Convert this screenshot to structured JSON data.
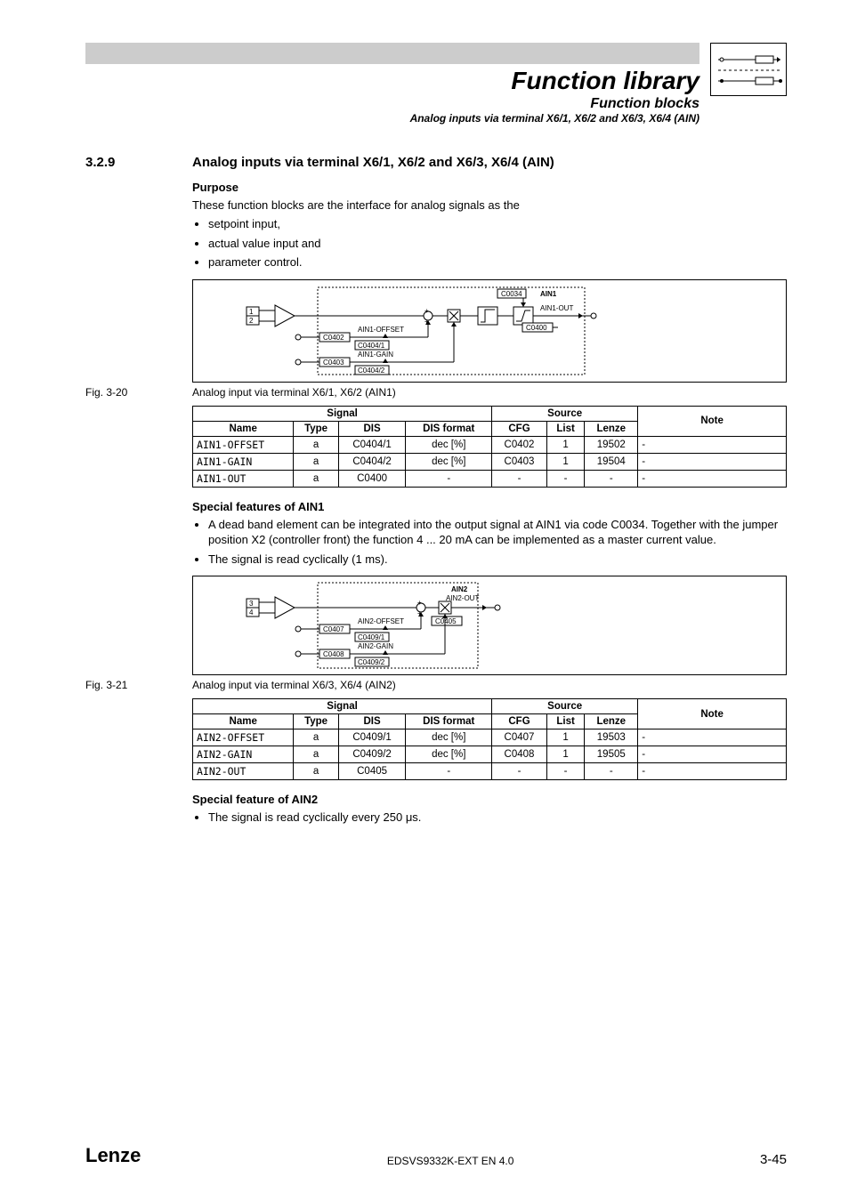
{
  "header": {
    "title": "Function library",
    "subtitle": "Function blocks",
    "smallTitle": "Analog inputs via terminal X6/1, X6/2 and X6/3, X6/4 (AIN)"
  },
  "section": {
    "num": "3.2.9",
    "title": "Analog inputs via terminal X6/1, X6/2 and X6/3, X6/4 (AIN)"
  },
  "purpose": {
    "head": "Purpose",
    "intro": "These function blocks are the interface for analog signals as the",
    "items": [
      "setpoint input,",
      "actual value input and",
      "parameter control."
    ]
  },
  "fig1": {
    "label": "Fig. 3-20",
    "caption": "Analog input via terminal X6/1, X6/2 (AIN1)"
  },
  "diagram1": {
    "name": "AIN1",
    "output": "AIN1-OUT",
    "pins": [
      "1",
      "2"
    ],
    "offset_label": "AIN1-OFFSET",
    "offset_code": "C0402",
    "offset_sub": "C0404/1",
    "gain_label": "AIN1-GAIN",
    "gain_code": "C0403",
    "gain_sub": "C0404/2",
    "extra_top": "C0034",
    "extra_out": "C0400"
  },
  "table1": {
    "headers": {
      "signal": "Signal",
      "name": "Name",
      "type": "Type",
      "dis": "DIS",
      "fmt": "DIS format",
      "source": "Source",
      "cfg": "CFG",
      "list": "List",
      "lenze": "Lenze",
      "note": "Note"
    },
    "rows": [
      {
        "name": "AIN1-OFFSET",
        "type": "a",
        "dis": "C0404/1",
        "fmt": "dec [%]",
        "cfg": "C0402",
        "list": "1",
        "lenze": "19502",
        "note": "-"
      },
      {
        "name": "AIN1-GAIN",
        "type": "a",
        "dis": "C0404/2",
        "fmt": "dec [%]",
        "cfg": "C0403",
        "list": "1",
        "lenze": "19504",
        "note": "-"
      },
      {
        "name": "AIN1-OUT",
        "type": "a",
        "dis": "C0400",
        "fmt": "-",
        "cfg": "-",
        "list": "-",
        "lenze": "-",
        "note": "-"
      }
    ]
  },
  "special1": {
    "head": "Special features of AIN1",
    "items": [
      "A dead band element can be integrated into the output signal at AIN1 via code C0034. Together with the jumper position X2 (controller front) the function 4 ... 20 mA can be implemented as a master current value.",
      "The signal is read cyclically (1 ms)."
    ]
  },
  "fig2": {
    "label": "Fig. 3-21",
    "caption": "Analog input via terminal X6/3, X6/4 (AIN2)"
  },
  "diagram2": {
    "name": "AIN2",
    "output": "AIN2-OUT",
    "pins": [
      "3",
      "4"
    ],
    "offset_label": "AIN2-OFFSET",
    "offset_code": "C0407",
    "offset_sub": "C0409/1",
    "gain_label": "AIN2-GAIN",
    "gain_code": "C0408",
    "gain_sub": "C0409/2",
    "extra_out": "C0405"
  },
  "table2": {
    "rows": [
      {
        "name": "AIN2-OFFSET",
        "type": "a",
        "dis": "C0409/1",
        "fmt": "dec [%]",
        "cfg": "C0407",
        "list": "1",
        "lenze": "19503",
        "note": "-"
      },
      {
        "name": "AIN2-GAIN",
        "type": "a",
        "dis": "C0409/2",
        "fmt": "dec [%]",
        "cfg": "C0408",
        "list": "1",
        "lenze": "19505",
        "note": "-"
      },
      {
        "name": "AIN2-OUT",
        "type": "a",
        "dis": "C0405",
        "fmt": "-",
        "cfg": "-",
        "list": "-",
        "lenze": "-",
        "note": "-"
      }
    ]
  },
  "special2": {
    "head": "Special feature of AIN2",
    "items": [
      "The signal is read cyclically every 250 μs."
    ]
  },
  "footer": {
    "brand": "Lenze",
    "docid": "EDSVS9332K-EXT EN 4.0",
    "page": "3-45"
  }
}
